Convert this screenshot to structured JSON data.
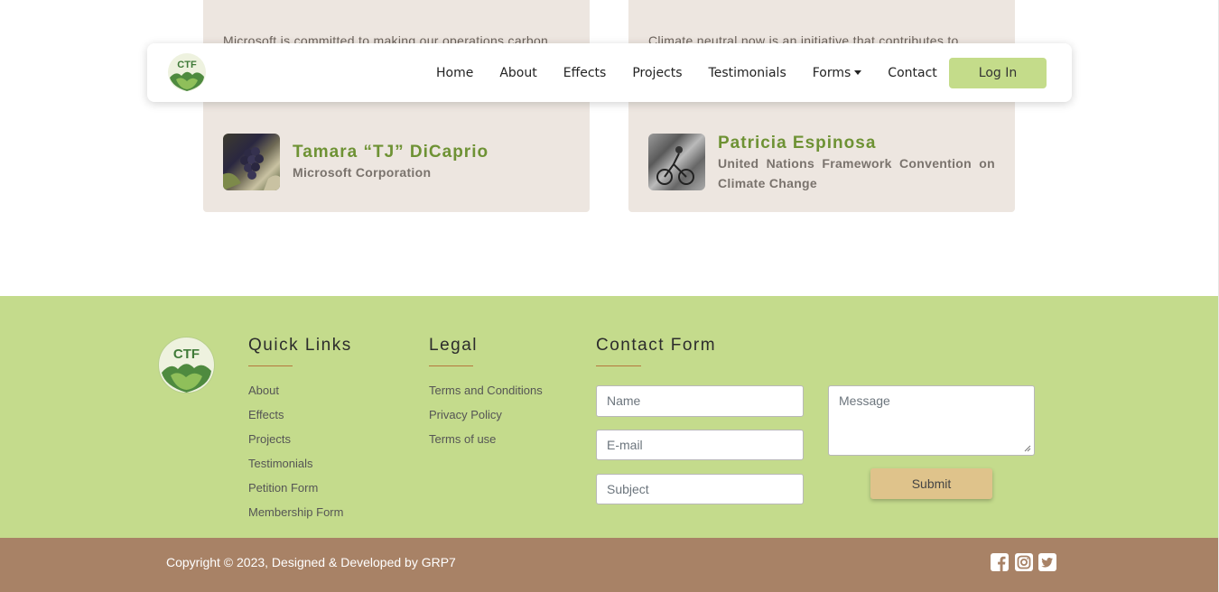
{
  "testimonials": [
    {
      "quote": "Microsoft is committed to making our operations carbon",
      "name": "Tamara “TJ” DiCaprio",
      "org": "Microsoft Corporation"
    },
    {
      "quote": "Climate neutral now is an initiative that contributes to",
      "name": "Patricia Espinosa",
      "org": "United Nations Framework Convention on Climate Change"
    }
  ],
  "nav": {
    "logo_text": "CTF",
    "links": [
      "Home",
      "About",
      "Effects",
      "Projects",
      "Testimonials",
      "Forms",
      "Contact"
    ],
    "login_label": "Log In"
  },
  "footer": {
    "logo_text": "CTF",
    "quick_links": {
      "title": "Quick Links",
      "items": [
        "About",
        "Effects",
        "Projects",
        "Testimonials",
        "Petition Form",
        "Membership Form"
      ]
    },
    "legal": {
      "title": "Legal",
      "items": [
        "Terms and Conditions",
        "Privacy Policy",
        "Terms of use"
      ]
    },
    "contact": {
      "title": "Contact Form",
      "name_placeholder": "Name",
      "email_placeholder": "E-mail",
      "subject_placeholder": "Subject",
      "message_placeholder": "Message",
      "submit_label": "Submit"
    },
    "copyright": "Copyright © 2023, Designed & Developed by GRP7",
    "social_icons": [
      "facebook-icon",
      "instagram-icon",
      "twitter-icon"
    ]
  },
  "colors": {
    "footer_bg": "#c4db8c",
    "bottom_bar": "#a88266",
    "name_green": "#6e9234",
    "login_bg": "#c4dc8a",
    "submit_bg": "#dfc38b"
  }
}
